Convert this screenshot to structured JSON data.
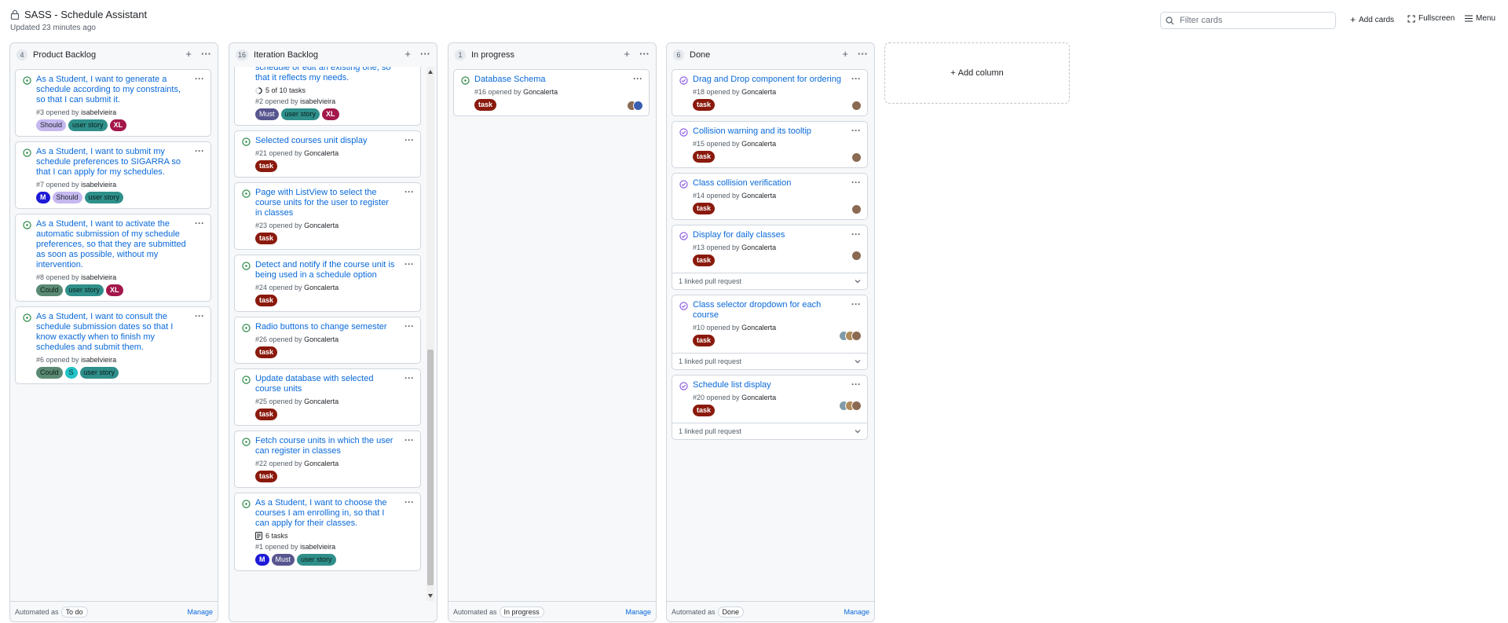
{
  "header": {
    "title": "SASS - Schedule Assistant",
    "updated": "Updated 23 minutes ago",
    "filter_placeholder": "Filter cards",
    "add_cards": "Add cards",
    "fullscreen": "Fullscreen",
    "menu": "Menu",
    "add_column": "Add column"
  },
  "columns": [
    {
      "name": "Product Backlog",
      "count": "4",
      "footer": {
        "automated_as": "Automated as",
        "state": "To do",
        "manage": "Manage"
      },
      "cards": [
        {
          "title": "As a Student, I want to generate a schedule according to my constraints, so that I can submit it.",
          "meta_num": "#3 opened by",
          "author": "isabelvieira",
          "labels": [
            "Should",
            "user story",
            "XL"
          ]
        },
        {
          "title": "As a Student, I want to submit my schedule preferences to SIGARRA so that I can apply for my schedules.",
          "meta_num": "#7 opened by",
          "author": "isabelvieira",
          "labels": [
            "M",
            "Should",
            "user story"
          ]
        },
        {
          "title": "As a Student, I want to activate the automatic submission of my schedule preferences, so that they are submitted as soon as possible, without my intervention.",
          "meta_num": "#8 opened by",
          "author": "isabelvieira",
          "labels": [
            "Could",
            "user story",
            "XL"
          ]
        },
        {
          "title": "As a Student, I want to consult the schedule submission dates so that I know exactly when to finish my schedules and submit them.",
          "meta_num": "#6 opened by",
          "author": "isabelvieira",
          "labels": [
            "Could",
            "S",
            "user story"
          ]
        }
      ]
    },
    {
      "name": "Iteration Backlog",
      "count": "16",
      "footer": {
        "automated_as": "",
        "state": "",
        "manage": ""
      },
      "cards": [
        {
          "title": "schedule or edit an existing one, so that it reflects my needs.",
          "tasks": "5 of 10 tasks",
          "meta_num": "#2 opened by",
          "author": "isabelvieira",
          "labels": [
            "Must",
            "user story",
            "XL"
          ]
        },
        {
          "title": "Selected courses unit display",
          "meta_num": "#21 opened by",
          "author": "Goncalerta",
          "labels": [
            "task"
          ]
        },
        {
          "title": "Page with ListView to select the course units for the user to register in classes",
          "meta_num": "#23 opened by",
          "author": "Goncalerta",
          "labels": [
            "task"
          ]
        },
        {
          "title": "Detect and notify if the course unit is being used in a schedule option",
          "meta_num": "#24 opened by",
          "author": "Goncalerta",
          "labels": [
            "task"
          ]
        },
        {
          "title": "Radio buttons to change semester",
          "meta_num": "#26 opened by",
          "author": "Goncalerta",
          "labels": [
            "task"
          ]
        },
        {
          "title": "Update database with selected course units",
          "meta_num": "#25 opened by",
          "author": "Goncalerta",
          "labels": [
            "task"
          ]
        },
        {
          "title": "Fetch course units in which the user can register in classes",
          "meta_num": "#22 opened by",
          "author": "Goncalerta",
          "labels": [
            "task"
          ]
        },
        {
          "title": "As a Student, I want to choose the courses I am enrolling in, so that I can apply for their classes.",
          "tasks": "6 tasks",
          "meta_num": "#1 opened by",
          "author": "isabelvieira",
          "labels": [
            "M",
            "Must",
            "user story"
          ]
        }
      ]
    },
    {
      "name": "In progress",
      "count": "1",
      "footer": {
        "automated_as": "Automated as",
        "state": "In progress",
        "manage": "Manage"
      },
      "cards": [
        {
          "title": "Database Schema",
          "meta_num": "#16 opened by",
          "author": "Goncalerta",
          "labels": [
            "task"
          ],
          "avatars": 2
        }
      ]
    },
    {
      "name": "Done",
      "count": "6",
      "footer": {
        "automated_as": "Automated as",
        "state": "Done",
        "manage": "Manage"
      },
      "cards": [
        {
          "title": "Drag and Drop component for ordering",
          "meta_num": "#18 opened by",
          "author": "Goncalerta",
          "labels": [
            "task"
          ],
          "avatars": 1
        },
        {
          "title": "Collision warning and its tooltip",
          "meta_num": "#15 opened by",
          "author": "Goncalerta",
          "labels": [
            "task"
          ],
          "avatars": 1
        },
        {
          "title": "Class collision verification",
          "meta_num": "#14 opened by",
          "author": "Goncalerta",
          "labels": [
            "task"
          ],
          "avatars": 1
        },
        {
          "title": "Display for daily classes",
          "meta_num": "#13 opened by",
          "author": "Goncalerta",
          "labels": [
            "task"
          ],
          "avatars": 1,
          "linked": "1 linked pull request"
        },
        {
          "title": "Class selector dropdown for each course",
          "meta_num": "#10 opened by",
          "author": "Goncalerta",
          "labels": [
            "task"
          ],
          "avatars": 3,
          "linked": "1 linked pull request"
        },
        {
          "title": "Schedule list display",
          "meta_num": "#20 opened by",
          "author": "Goncalerta",
          "labels": [
            "task"
          ],
          "avatars": 3,
          "linked": "1 linked pull request"
        }
      ]
    }
  ]
}
